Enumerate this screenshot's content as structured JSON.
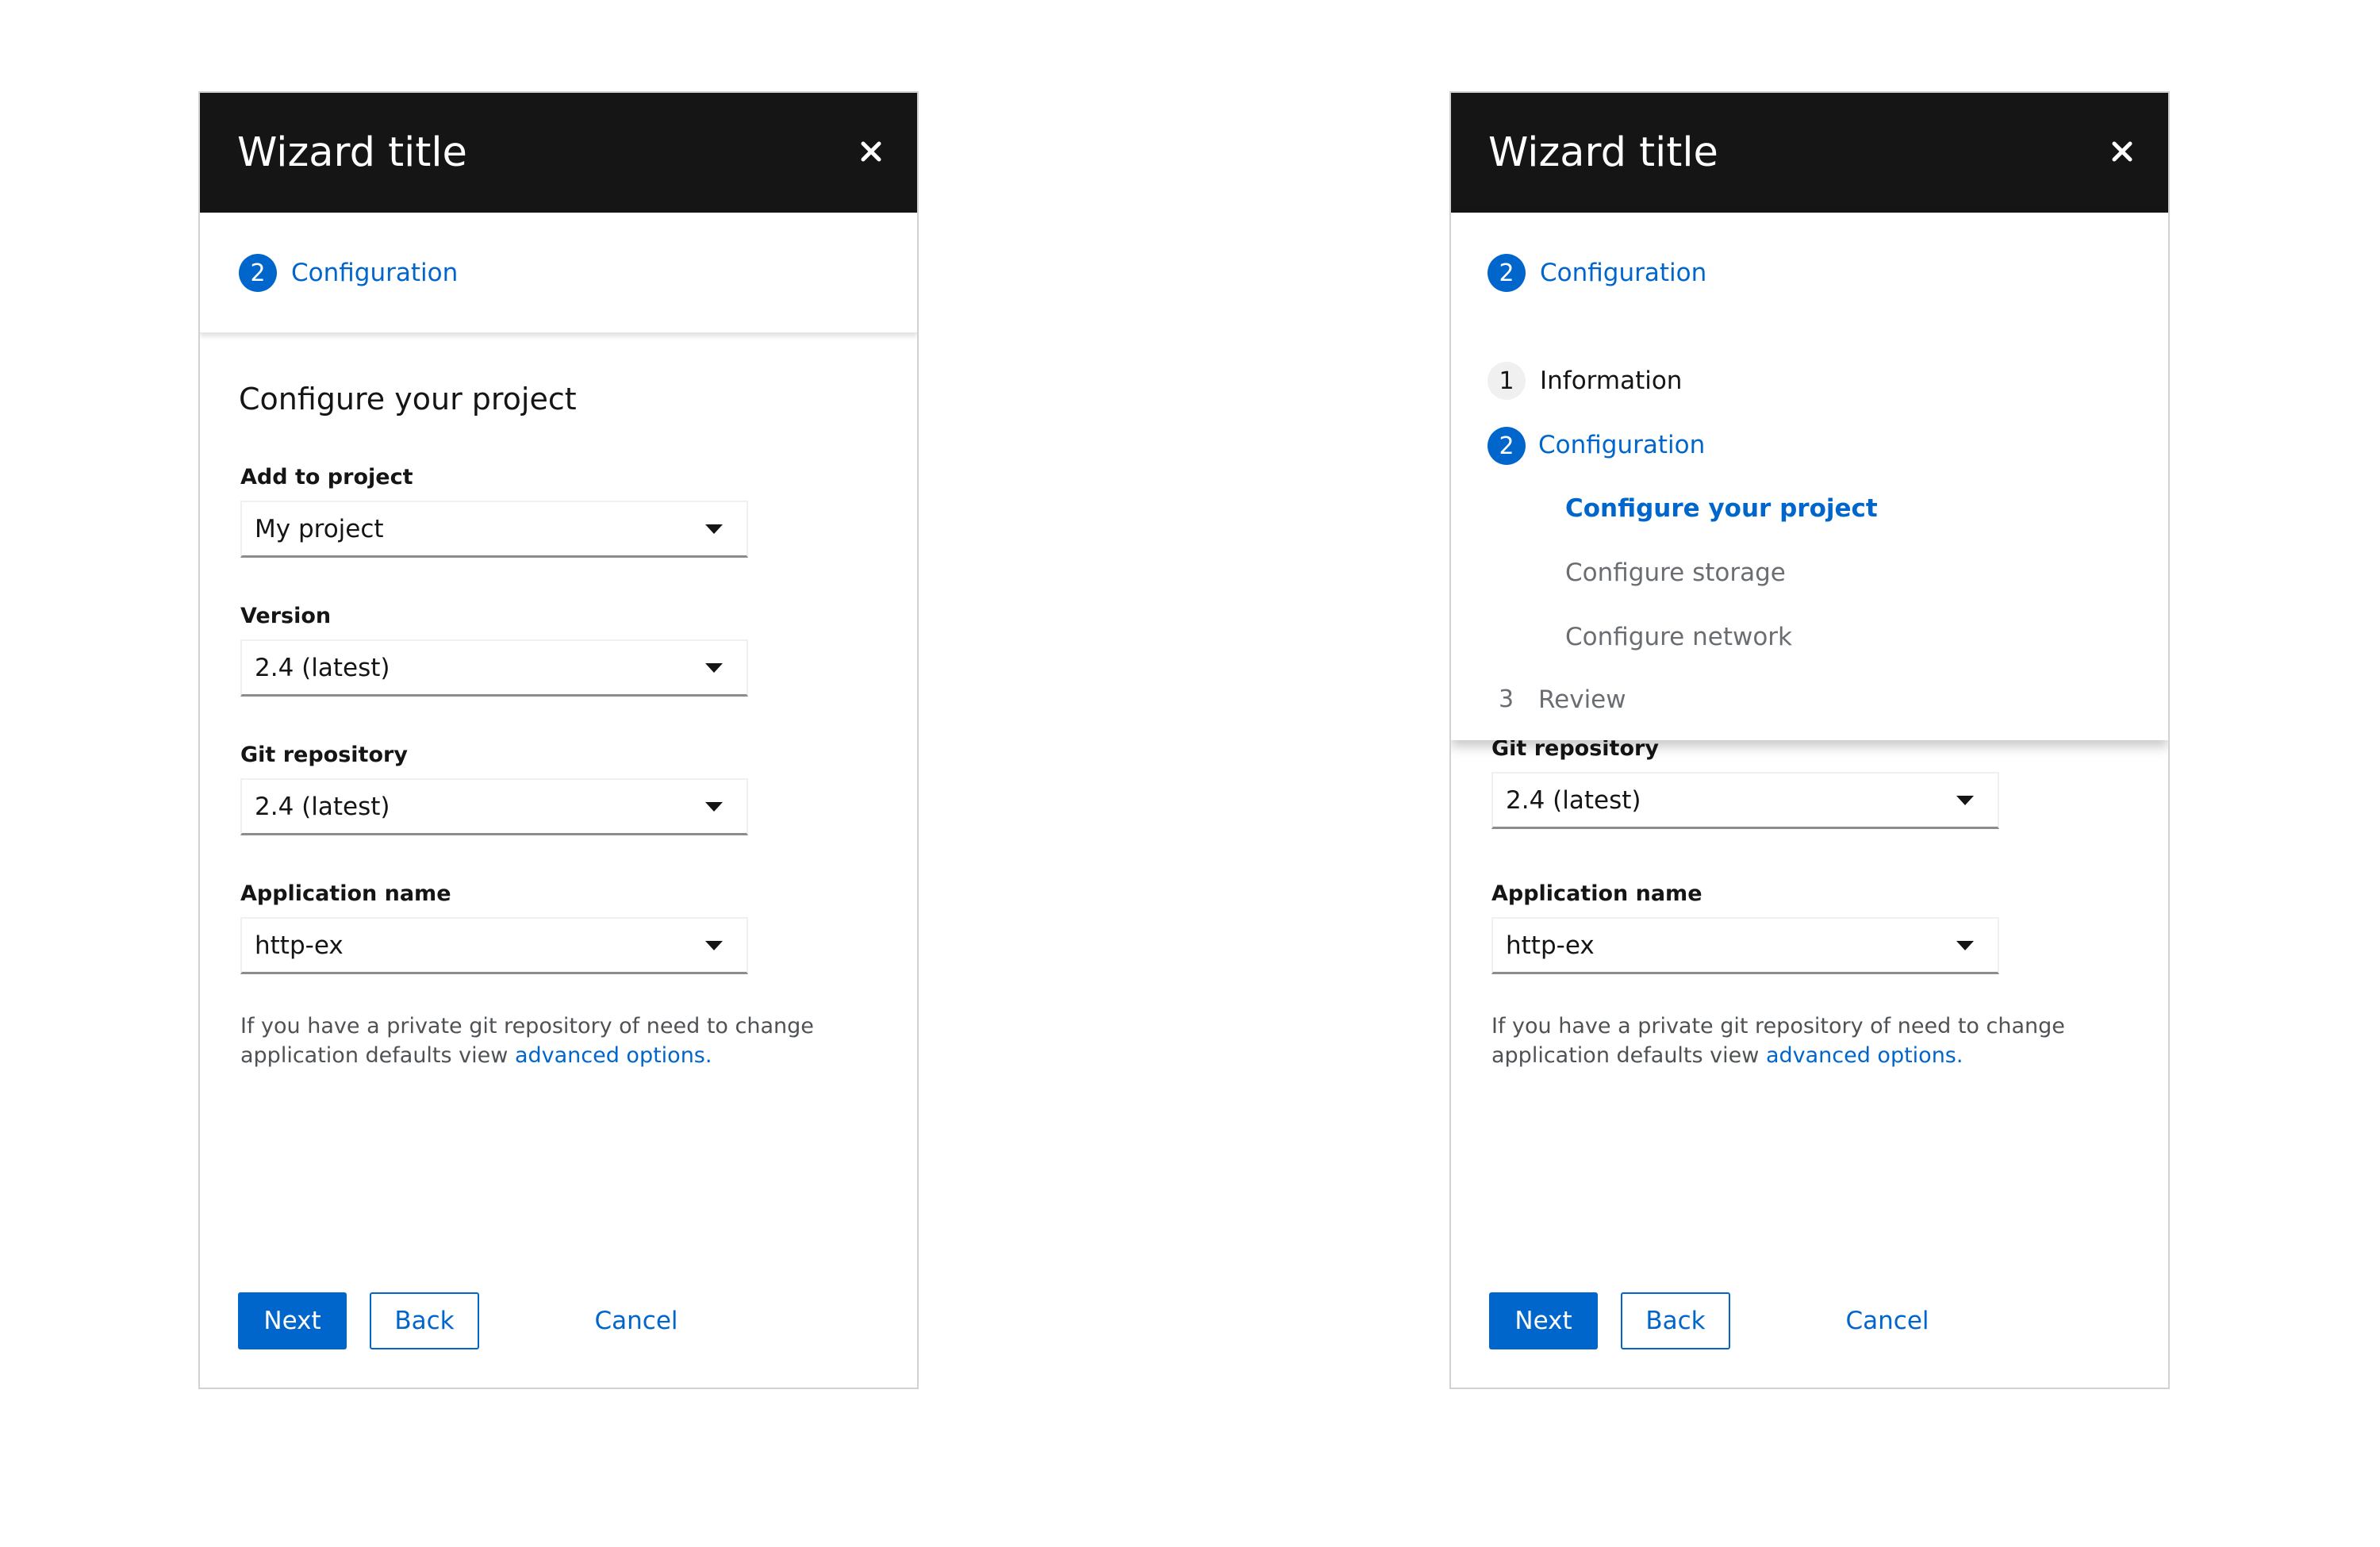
{
  "left_wizard": {
    "title": "Wizard title",
    "current_step": {
      "number": "2",
      "label": "Configuration"
    },
    "body_title": "Configure your project",
    "fields": [
      {
        "label": "Add to project",
        "value": "My project"
      },
      {
        "label": "Version",
        "value": "2.4 (latest)"
      },
      {
        "label": "Git repository",
        "value": "2.4 (latest)"
      },
      {
        "label": "Application name",
        "value": "http-ex"
      }
    ],
    "help_text": "If you have a private git repository of need to change application defaults view ",
    "help_link": "advanced options.",
    "buttons": {
      "next": "Next",
      "back": "Back",
      "cancel": "Cancel"
    }
  },
  "right_wizard": {
    "title": "Wizard title",
    "current_step": {
      "number": "2",
      "label": "Configuration"
    },
    "nav": {
      "steps": [
        {
          "number": "1",
          "label": "Information"
        },
        {
          "number": "2",
          "label": "Configuration"
        },
        {
          "number": "3",
          "label": "Review"
        }
      ],
      "substeps": [
        {
          "label": "Configure your project",
          "current": true
        },
        {
          "label": "Configure storage",
          "current": false
        },
        {
          "label": "Configure network",
          "current": false
        }
      ]
    },
    "fields": [
      {
        "label": "Git repository",
        "value": "2.4 (latest)"
      },
      {
        "label": "Application name",
        "value": "http-ex"
      }
    ],
    "help_text": "If you have a private git repository of need to change application defaults view ",
    "help_link": "advanced options.",
    "buttons": {
      "next": "Next",
      "back": "Back",
      "cancel": "Cancel"
    }
  },
  "icons": {
    "close": "close-icon",
    "dropdown": "caret-down-icon"
  },
  "colors": {
    "primary": "#0066cc",
    "header_bg": "#151515",
    "border": "#d2d2d2"
  }
}
